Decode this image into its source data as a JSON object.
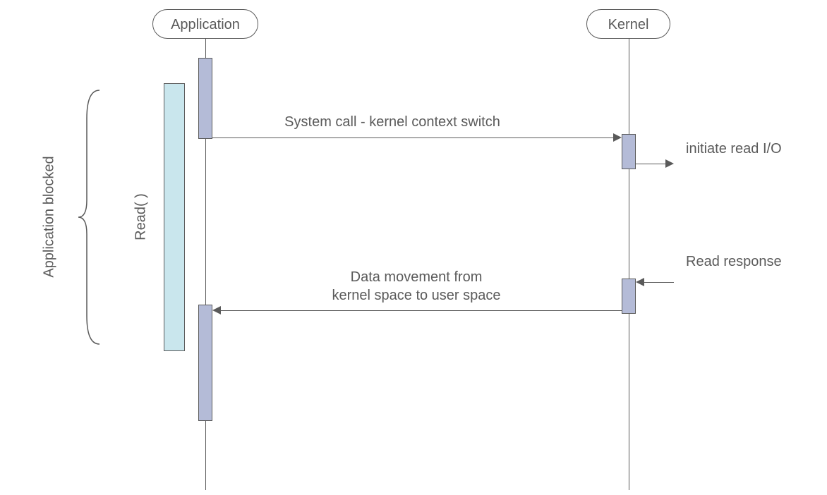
{
  "lifelines": {
    "application": {
      "label": "Application"
    },
    "kernel": {
      "label": "Kernel"
    }
  },
  "messages": {
    "syscall": {
      "label": "System call - kernel context switch"
    },
    "datamove": {
      "line1": "Data movement from",
      "line2": "kernel space to user space"
    },
    "initiate": {
      "label": "initiate read I/O"
    },
    "response": {
      "label": "Read response"
    }
  },
  "annotations": {
    "read": {
      "label": "Read( )"
    },
    "blocked": {
      "label": "Application blocked"
    }
  }
}
